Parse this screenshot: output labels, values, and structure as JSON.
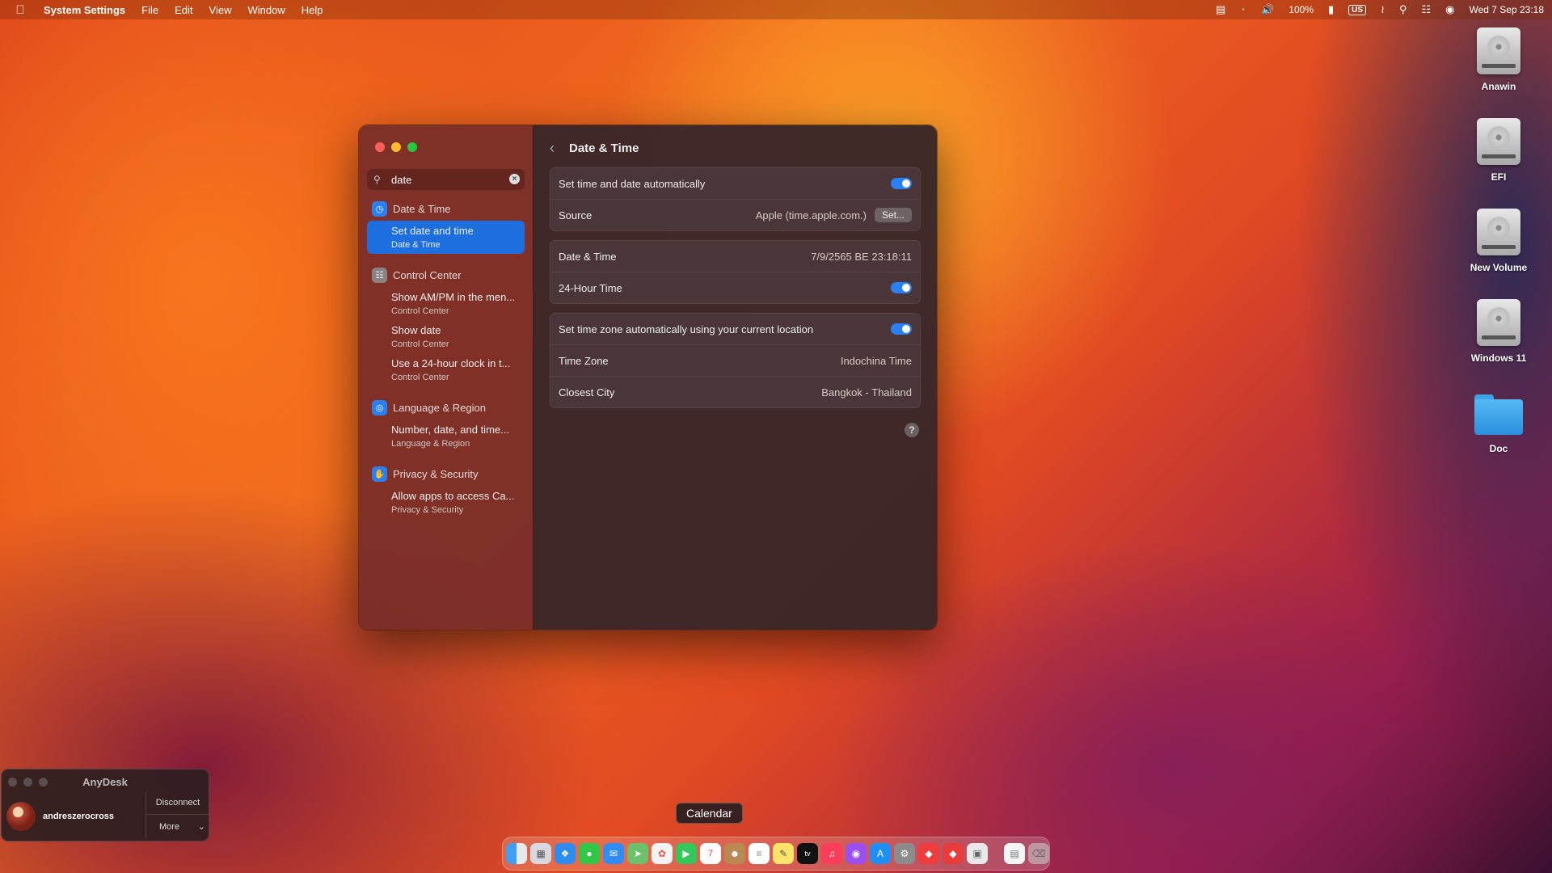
{
  "menubar": {
    "app_name": "System Settings",
    "menus": [
      "File",
      "Edit",
      "View",
      "Window",
      "Help"
    ],
    "battery": "100%",
    "keyboard": "US",
    "clock": "Wed 7 Sep  23:18"
  },
  "desktop_icons": [
    {
      "label": "Anawin",
      "kind": "disk"
    },
    {
      "label": "EFI",
      "kind": "disk"
    },
    {
      "label": "New Volume",
      "kind": "disk"
    },
    {
      "label": "Windows 11",
      "kind": "disk"
    },
    {
      "label": "Doc",
      "kind": "folder"
    }
  ],
  "sidebar": {
    "search_value": "date",
    "groups": [
      {
        "title": "Date & Time",
        "results": [
          {
            "title": "Set date and time",
            "subtitle": "Date & Time"
          }
        ]
      },
      {
        "title": "Control Center",
        "results": [
          {
            "title": "Show AM/PM in the men...",
            "subtitle": "Control Center"
          },
          {
            "title": "Show date",
            "subtitle": "Control Center"
          },
          {
            "title": "Use a 24-hour clock in t...",
            "subtitle": "Control Center"
          }
        ]
      },
      {
        "title": "Language & Region",
        "results": [
          {
            "title": "Number, date, and time...",
            "subtitle": "Language & Region"
          }
        ]
      },
      {
        "title": "Privacy & Security",
        "results": [
          {
            "title": "Allow apps to access Ca...",
            "subtitle": "Privacy & Security"
          }
        ]
      }
    ]
  },
  "main": {
    "title": "Date & Time",
    "set_auto_label": "Set time and date automatically",
    "source_label": "Source",
    "source_value": "Apple (time.apple.com.)",
    "set_button": "Set...",
    "datetime_label": "Date & Time",
    "datetime_value": "7/9/2565 BE 23:18:11",
    "hour24_label": "24-Hour Time",
    "tz_auto_label": "Set time zone automatically using your current location",
    "tz_label": "Time Zone",
    "tz_value": "Indochina Time",
    "city_label": "Closest City",
    "city_value": "Bangkok - Thailand",
    "help": "?"
  },
  "anydesk": {
    "title": "AnyDesk",
    "user": "andreszerocross",
    "disconnect": "Disconnect",
    "more": "More"
  },
  "dock": {
    "tooltip": "Calendar",
    "apps": [
      "Finder",
      "Launchpad",
      "Safari",
      "Messages",
      "Mail",
      "Maps",
      "Photos",
      "FaceTime",
      "Calendar",
      "Contacts",
      "Reminders",
      "Notes",
      "TV",
      "Music",
      "Podcasts",
      "App Store",
      "System Settings",
      "AnyDesk",
      "AnyDesk 2",
      "Preview",
      "Documents",
      "Trash"
    ]
  }
}
